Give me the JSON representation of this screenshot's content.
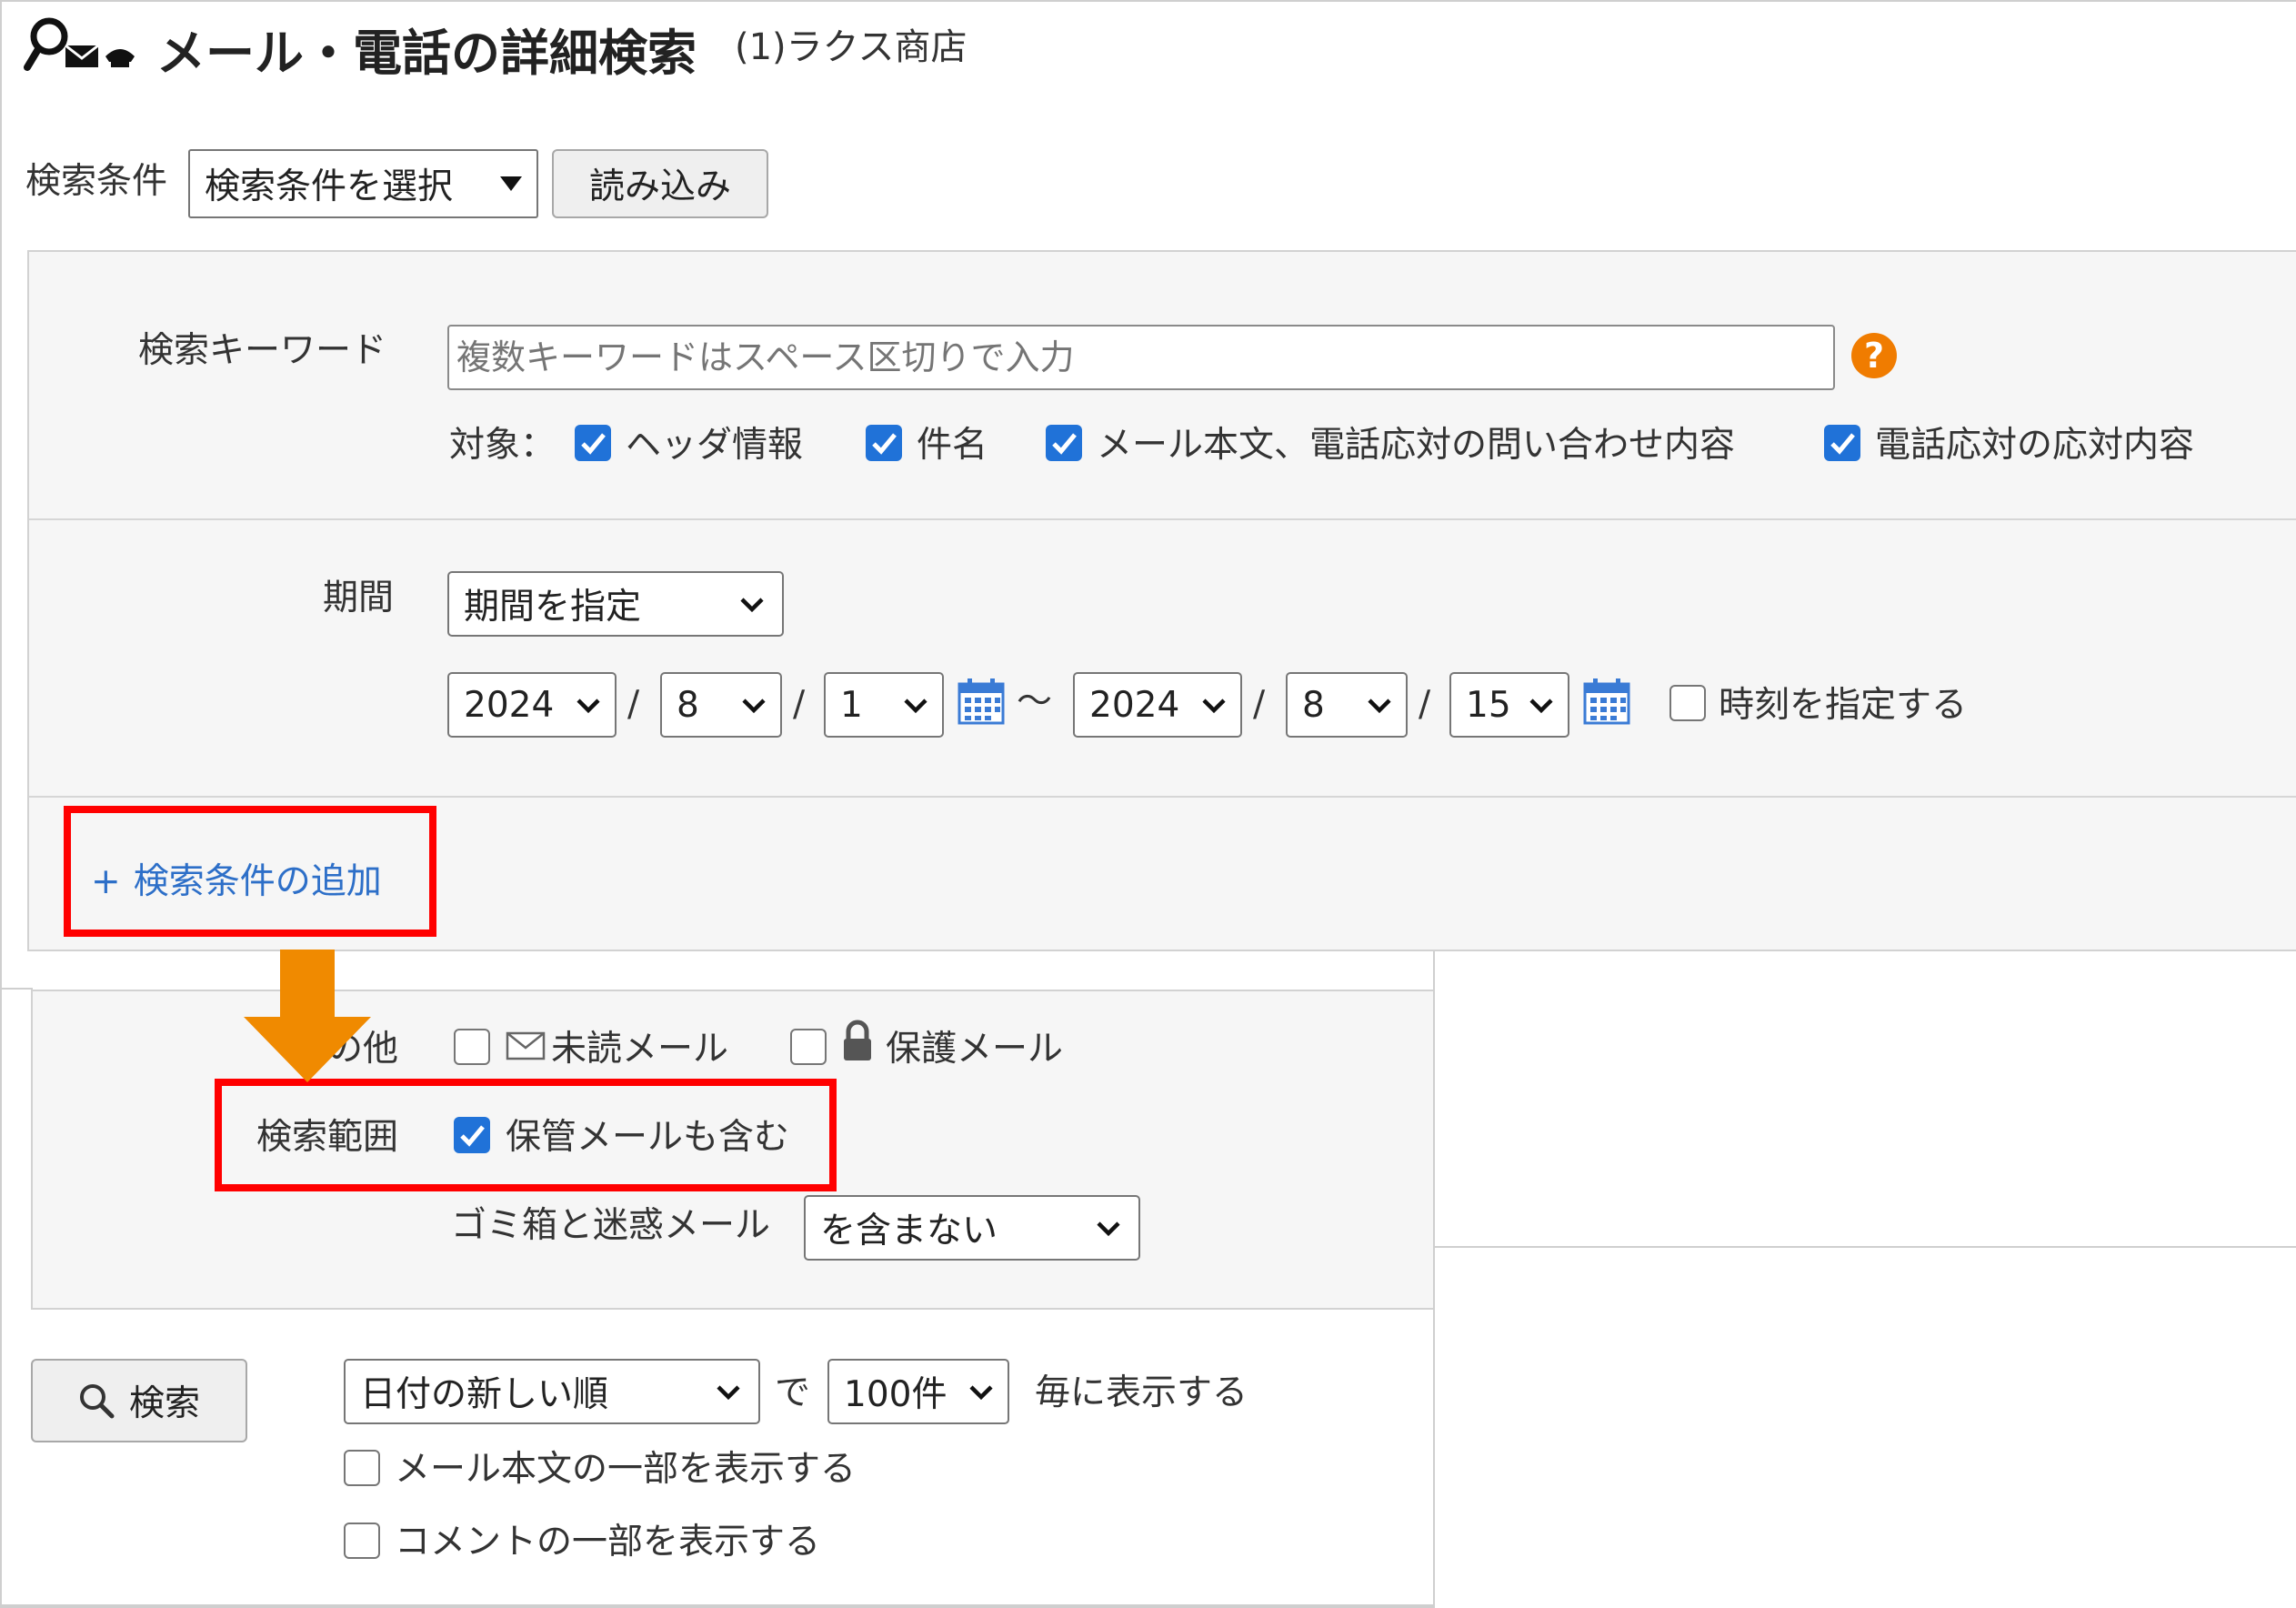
{
  "header": {
    "title": "メール・電話の詳細検索",
    "shop": "(1)ラクス商店",
    "icon": "search-mail-phone-icon"
  },
  "saved_conditions": {
    "label": "検索条件",
    "select_value": "検索条件を選択",
    "load_button": "読み込み"
  },
  "keyword": {
    "label": "検索キーワード",
    "placeholder": "複数キーワードはスペース区切りで入力",
    "help_icon": "?",
    "target_label": "対象：",
    "targets": [
      {
        "label": "ヘッダ情報",
        "checked": true
      },
      {
        "label": "件名",
        "checked": true
      },
      {
        "label": "メール本文、電話応対の問い合わせ内容",
        "checked": true
      },
      {
        "label": "電話応対の応対内容",
        "checked": true
      }
    ]
  },
  "period": {
    "label": "期間",
    "mode": "期間を指定",
    "from": {
      "year": "2024",
      "month": "8",
      "day": "1"
    },
    "to": {
      "year": "2024",
      "month": "8",
      "day": "15"
    },
    "slash": "/",
    "tilde": "～",
    "time_label": "時刻を指定する",
    "time_checked": false
  },
  "add_condition": {
    "plus": "+",
    "label": "検索条件の追加"
  },
  "other": {
    "label": "の他",
    "unread_label": "未読メール",
    "protected_label": "保護メール"
  },
  "scope": {
    "label": "検索範囲",
    "archive_label": "保管メールも含む",
    "archive_checked": true,
    "trash_label": "ゴミ箱と迷惑メール",
    "trash_value": "を含まない"
  },
  "search": {
    "button_label": "検索",
    "sort_value": "日付の新しい順",
    "de": "で",
    "per_page_value": "100件",
    "per_page_suffix": "毎に表示する",
    "show_body_label": "メール本文の一部を表示する",
    "show_comment_label": "コメントの一部を表示する"
  },
  "colors": {
    "highlight": "#ff0000",
    "arrow": "#f08a00",
    "checkbox": "#2072d8",
    "link": "#2d6fc8",
    "help": "#f07c00",
    "calendar": "#3a7bd5"
  }
}
